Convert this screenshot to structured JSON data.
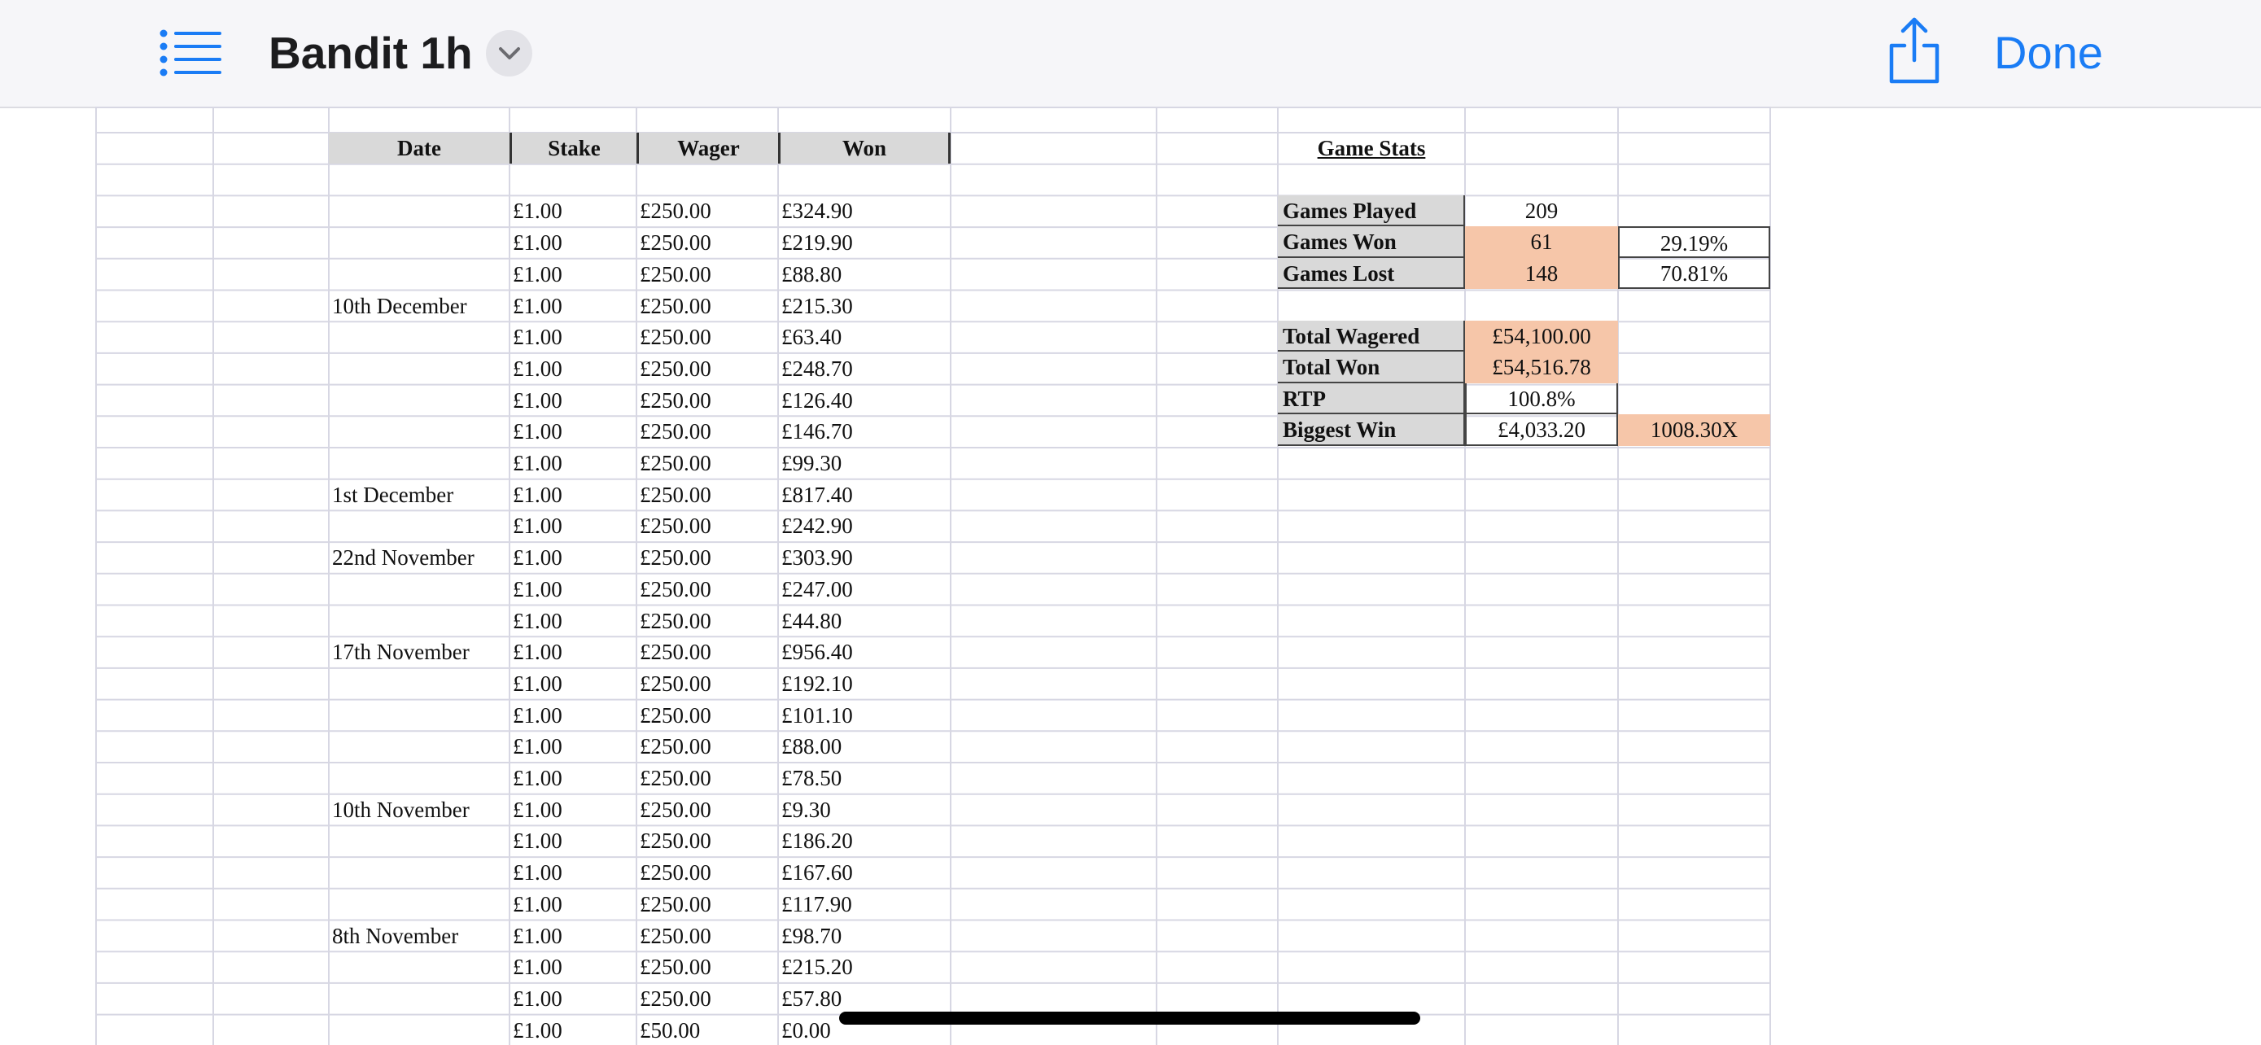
{
  "toolbar": {
    "title": "Bandit 1h",
    "done_label": "Done",
    "icons": {
      "list": "list-icon",
      "chevron": "chevron-down-icon",
      "share": "share-icon"
    },
    "accent_color": "#1a7cf5"
  },
  "table": {
    "headers": [
      "Date",
      "Stake",
      "Wager",
      "Won"
    ],
    "rows": [
      [
        "",
        "£1.00",
        "£250.00",
        "£324.90"
      ],
      [
        "",
        "£1.00",
        "£250.00",
        "£219.90"
      ],
      [
        "",
        "£1.00",
        "£250.00",
        "£88.80"
      ],
      [
        "10th December",
        "£1.00",
        "£250.00",
        "£215.30"
      ],
      [
        "",
        "£1.00",
        "£250.00",
        "£63.40"
      ],
      [
        "",
        "£1.00",
        "£250.00",
        "£248.70"
      ],
      [
        "",
        "£1.00",
        "£250.00",
        "£126.40"
      ],
      [
        "",
        "£1.00",
        "£250.00",
        "£146.70"
      ],
      [
        "",
        "£1.00",
        "£250.00",
        "£99.30"
      ],
      [
        "1st December",
        "£1.00",
        "£250.00",
        "£817.40"
      ],
      [
        "",
        "£1.00",
        "£250.00",
        "£242.90"
      ],
      [
        "22nd November",
        "£1.00",
        "£250.00",
        "£303.90"
      ],
      [
        "",
        "£1.00",
        "£250.00",
        "£247.00"
      ],
      [
        "",
        "£1.00",
        "£250.00",
        "£44.80"
      ],
      [
        "17th November",
        "£1.00",
        "£250.00",
        "£956.40"
      ],
      [
        "",
        "£1.00",
        "£250.00",
        "£192.10"
      ],
      [
        "",
        "£1.00",
        "£250.00",
        "£101.10"
      ],
      [
        "",
        "£1.00",
        "£250.00",
        "£88.00"
      ],
      [
        "",
        "£1.00",
        "£250.00",
        "£78.50"
      ],
      [
        "10th November",
        "£1.00",
        "£250.00",
        "£9.30"
      ],
      [
        "",
        "£1.00",
        "£250.00",
        "£186.20"
      ],
      [
        "",
        "£1.00",
        "£250.00",
        "£167.60"
      ],
      [
        "",
        "£1.00",
        "£250.00",
        "£117.90"
      ],
      [
        "8th November",
        "£1.00",
        "£250.00",
        "£98.70"
      ],
      [
        "",
        "£1.00",
        "£250.00",
        "£215.20"
      ],
      [
        "",
        "£1.00",
        "£250.00",
        "£57.80"
      ],
      [
        "",
        "£1.00",
        "£50.00",
        "£0.00"
      ]
    ]
  },
  "game_stats": {
    "title": "Game Stats",
    "games_played": {
      "label": "Games Played",
      "value": "209"
    },
    "games_won": {
      "label": "Games Won",
      "value": "61",
      "pct": "29.19%"
    },
    "games_lost": {
      "label": "Games Lost",
      "value": "148",
      "pct": "70.81%"
    },
    "total_wagered": {
      "label": "Total Wagered",
      "value": "£54,100.00"
    },
    "total_won": {
      "label": "Total Won",
      "value": "£54,516.78"
    },
    "rtp": {
      "label": "RTP",
      "value": "100.8%"
    },
    "biggest_win": {
      "label": "Biggest Win",
      "value": "£4,033.20",
      "multiplier": "1008.30X"
    }
  },
  "colors": {
    "highlight": "#f6c6a9",
    "label_bg": "#d9d9d9",
    "gridline": "#d7d7e3"
  }
}
